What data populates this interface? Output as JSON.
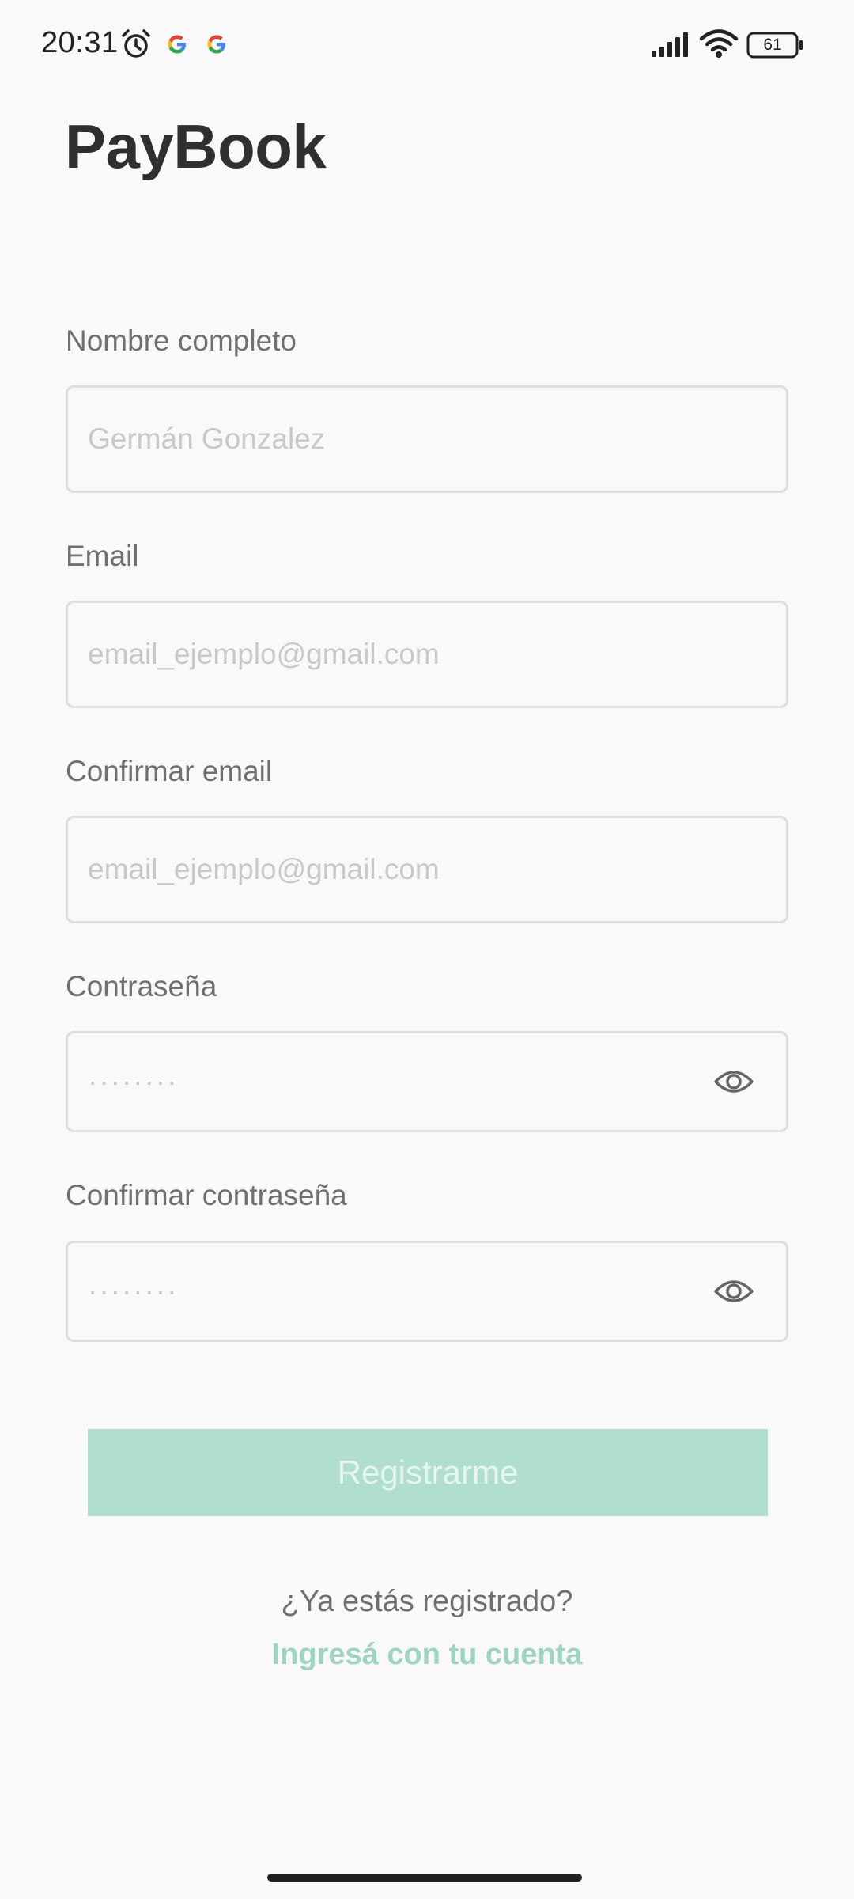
{
  "status_bar": {
    "time": "20:31",
    "battery_level": "61",
    "icons": [
      "alarm-icon",
      "google-icon",
      "google-icon",
      "signal-icon",
      "wifi-icon",
      "battery-icon"
    ]
  },
  "app": {
    "title": "PayBook"
  },
  "form": {
    "full_name": {
      "label": "Nombre completo",
      "value": "",
      "placeholder": "Germán Gonzalez"
    },
    "email": {
      "label": "Email",
      "value": "",
      "placeholder": "email_ejemplo@gmail.com"
    },
    "confirm_email": {
      "label": "Confirmar email",
      "value": "",
      "placeholder": "email_ejemplo@gmail.com"
    },
    "password": {
      "label": "Contraseña",
      "value": "",
      "placeholder": "········",
      "toggle_icon": "eye-icon"
    },
    "confirm_password": {
      "label": "Confirmar contraseña",
      "value": "",
      "placeholder": "········",
      "toggle_icon": "eye-icon"
    },
    "submit_label": "Registrarme"
  },
  "footer": {
    "already_registered": "¿Ya estás registrado?",
    "login_link": "Ingresá con tu cuenta"
  },
  "colors": {
    "background": "#f9f9f9",
    "accent": "#9dd5c0",
    "button_disabled": "#b1dfcd",
    "text_primary": "#2f2f2f",
    "text_secondary": "#707070",
    "border": "#dedede",
    "placeholder": "#c9c9c9"
  }
}
